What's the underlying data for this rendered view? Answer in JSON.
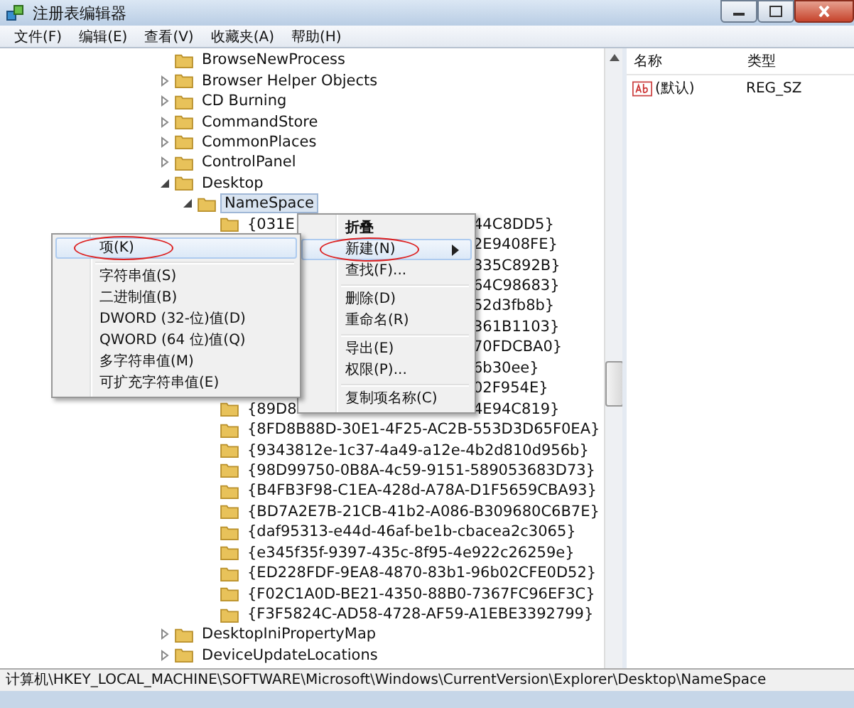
{
  "window": {
    "title": "注册表编辑器"
  },
  "menu": [
    "文件(F)",
    "编辑(E)",
    "查看(V)",
    "收藏夹(A)",
    "帮助(H)"
  ],
  "tree": [
    {
      "kind": "folder",
      "name": "BrowseNewProcess",
      "selected": false
    },
    {
      "kind": "folder",
      "name": "Browser Helper Objects",
      "expanded": false,
      "selected": false
    },
    {
      "kind": "folder",
      "name": "CD Burning",
      "expanded": false,
      "selected": false
    },
    {
      "kind": "folder",
      "name": "CommandStore",
      "expanded": false,
      "selected": false
    },
    {
      "kind": "folder",
      "name": "CommonPlaces",
      "expanded": false,
      "selected": false
    },
    {
      "kind": "folder",
      "name": "ControlPanel",
      "expanded": false,
      "selected": false
    },
    {
      "kind": "folder",
      "name": "Desktop",
      "expanded": true,
      "selected": false,
      "children": [
        {
          "kind": "folder",
          "name": "NameSpace",
          "expanded": true,
          "selected": true,
          "children": [
            {
              "kind": "folder",
              "name": "{031E",
              "tail": "44C8DD5}",
              "selected": false
            },
            {
              "kind": "covered",
              "tail": "2E9408FE}"
            },
            {
              "kind": "covered",
              "tail": "335C892B}"
            },
            {
              "kind": "covered",
              "tail": "64C98683}"
            },
            {
              "kind": "covered",
              "tail": "52d3fb8b}"
            },
            {
              "kind": "covered",
              "tail": "361B1103}"
            },
            {
              "kind": "covered",
              "tail": "70FDCBA0}"
            },
            {
              "kind": "covered",
              "tail": "6b30ee}"
            },
            {
              "kind": "covered",
              "tail": "02F954E}"
            },
            {
              "kind": "folder",
              "name": "{89D8",
              "tail": "4E94C819}",
              "selected": false
            },
            {
              "kind": "folder",
              "name": "{8FD8B88D-30E1-4F25-AC2B-553D3D65F0EA}",
              "selected": false
            },
            {
              "kind": "folder",
              "name": "{9343812e-1c37-4a49-a12e-4b2d810d956b}",
              "selected": false
            },
            {
              "kind": "folder",
              "name": "{98D99750-0B8A-4c59-9151-589053683D73}",
              "selected": false
            },
            {
              "kind": "folder",
              "name": "{B4FB3F98-C1EA-428d-A78A-D1F5659CBA93}",
              "selected": false
            },
            {
              "kind": "folder",
              "name": "{BD7A2E7B-21CB-41b2-A086-B309680C6B7E}",
              "selected": false
            },
            {
              "kind": "folder",
              "name": "{daf95313-e44d-46af-be1b-cbacea2c3065}",
              "selected": false
            },
            {
              "kind": "folder",
              "name": "{e345f35f-9397-435c-8f95-4e922c26259e}",
              "selected": false
            },
            {
              "kind": "folder",
              "name": "{ED228FDF-9EA8-4870-83b1-96b02CFE0D52}",
              "selected": false
            },
            {
              "kind": "folder",
              "name": "{F02C1A0D-BE21-4350-88B0-7367FC96EF3C}",
              "selected": false
            },
            {
              "kind": "folder",
              "name": "{F3F5824C-AD58-4728-AF59-A1EBE3392799}",
              "selected": false
            }
          ]
        }
      ]
    },
    {
      "kind": "folder",
      "name": "DesktopIniPropertyMap",
      "expanded": false,
      "selected": false
    },
    {
      "kind": "folder",
      "name": "DeviceUpdateLocations",
      "expanded": false,
      "selected": false
    }
  ],
  "context_menu": [
    {
      "kind": "item",
      "label": "折叠",
      "bold": true,
      "selected": false,
      "submenu": false,
      "circled": false
    },
    {
      "kind": "item",
      "label": "新建(N)",
      "bold": false,
      "selected": true,
      "submenu": true,
      "circled": true
    },
    {
      "kind": "item",
      "label": "查找(F)...",
      "bold": false,
      "selected": false,
      "submenu": false,
      "circled": false
    },
    {
      "kind": "separator"
    },
    {
      "kind": "item",
      "label": "删除(D)",
      "bold": false,
      "selected": false,
      "submenu": false,
      "circled": false
    },
    {
      "kind": "item",
      "label": "重命名(R)",
      "bold": false,
      "selected": false,
      "submenu": false,
      "circled": false
    },
    {
      "kind": "separator"
    },
    {
      "kind": "item",
      "label": "导出(E)",
      "bold": false,
      "selected": false,
      "submenu": false,
      "circled": false
    },
    {
      "kind": "item",
      "label": "权限(P)...",
      "bold": false,
      "selected": false,
      "submenu": false,
      "circled": false
    },
    {
      "kind": "separator"
    },
    {
      "kind": "item",
      "label": "复制项名称(C)",
      "bold": false,
      "selected": false,
      "submenu": false,
      "circled": false
    }
  ],
  "submenu": [
    {
      "kind": "item",
      "label": "项(K)",
      "bold": false,
      "selected": true,
      "submenu": false,
      "circled": true
    },
    {
      "kind": "separator"
    },
    {
      "kind": "item",
      "label": "字符串值(S)",
      "bold": false,
      "selected": false,
      "submenu": false,
      "circled": false
    },
    {
      "kind": "item",
      "label": "二进制值(B)",
      "bold": false,
      "selected": false,
      "submenu": false,
      "circled": false
    },
    {
      "kind": "item",
      "label": "DWORD (32-位)值(D)",
      "bold": false,
      "selected": false,
      "submenu": false,
      "circled": false
    },
    {
      "kind": "item",
      "label": "QWORD (64 位)值(Q)",
      "bold": false,
      "selected": false,
      "submenu": false,
      "circled": false
    },
    {
      "kind": "item",
      "label": "多字符串值(M)",
      "bold": false,
      "selected": false,
      "submenu": false,
      "circled": false
    },
    {
      "kind": "item",
      "label": "可扩充字符串值(E)",
      "bold": false,
      "selected": false,
      "submenu": false,
      "circled": false
    }
  ],
  "values": {
    "columns": [
      "名称",
      "类型"
    ],
    "rows": [
      {
        "name": "(默认)",
        "type": "REG_SZ"
      }
    ]
  },
  "status_bar": "计算机\\HKEY_LOCAL_MACHINE\\SOFTWARE\\Microsoft\\Windows\\CurrentVersion\\Explorer\\Desktop\\NameSpace"
}
